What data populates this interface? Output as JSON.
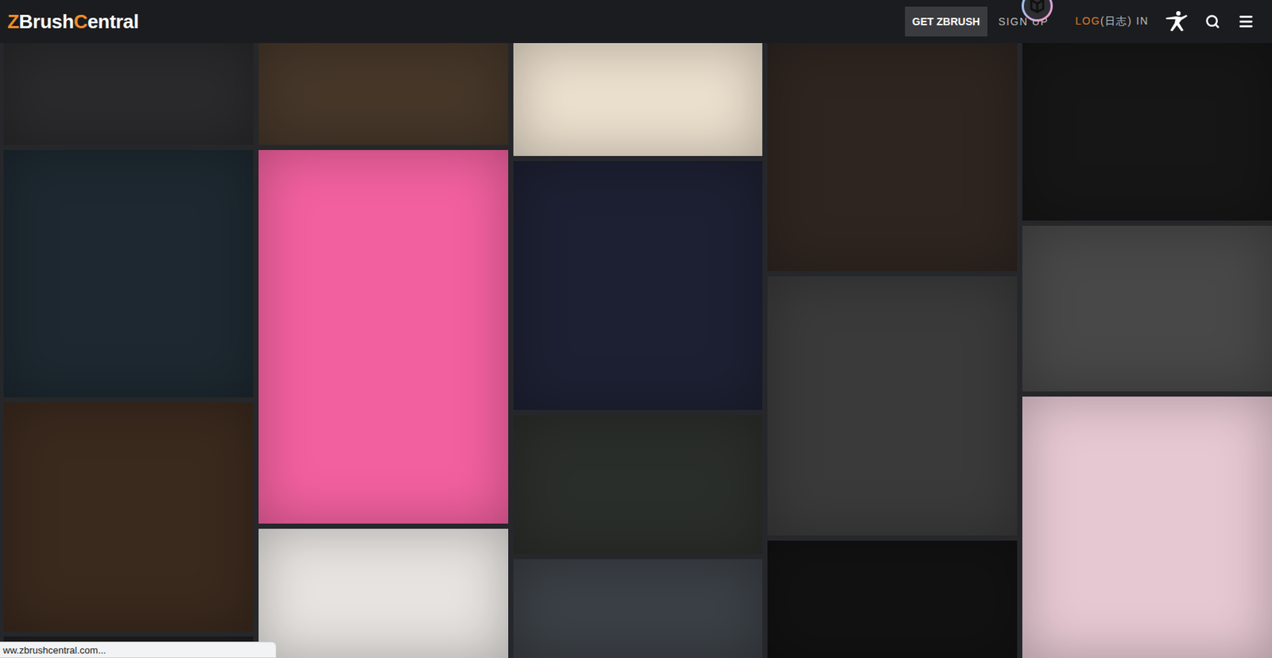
{
  "header": {
    "logo": [
      {
        "text": "Z",
        "color": "#f28c28"
      },
      {
        "text": "Brush",
        "color": "#ffffff"
      },
      {
        "text": "C",
        "color": "#f28c28"
      },
      {
        "text": "entral",
        "color": "#ffffff"
      }
    ],
    "nav": {
      "get_button": "GET ZBRUSH",
      "sign_up": "SIGN UP",
      "log_in": [
        {
          "text": "LOG",
          "color": "#e07a2c"
        },
        {
          "text": "(日志) IN",
          "color": "#bdbdbd"
        }
      ]
    }
  },
  "gallery": {
    "columns": [
      {
        "tiles": [
          {
            "color": "#2a2a2c"
          },
          {
            "color": "#1d2830"
          },
          {
            "color": "#3a291d"
          },
          {
            "color": "#1f1f1f"
          }
        ]
      },
      {
        "tiles": [
          {
            "color": "#463729"
          },
          {
            "color": "#f2609f"
          },
          {
            "color": "#e6e3e0"
          }
        ]
      },
      {
        "tiles": [
          {
            "color": "#ebdfcd"
          },
          {
            "color": "#1d2032"
          },
          {
            "color": "#2a2e2a"
          },
          {
            "color": "#3b4046"
          }
        ]
      },
      {
        "tiles": [
          {
            "color": "#2e2520"
          },
          {
            "color": "#3a3a3a"
          },
          {
            "color": "#121212"
          }
        ]
      },
      {
        "tiles": [
          {
            "color": "#161616"
          },
          {
            "color": "#484848"
          },
          {
            "color": "#e6c8d2"
          }
        ]
      }
    ]
  },
  "status_bar": {
    "url": "ww.zbrushcentral.com..."
  }
}
